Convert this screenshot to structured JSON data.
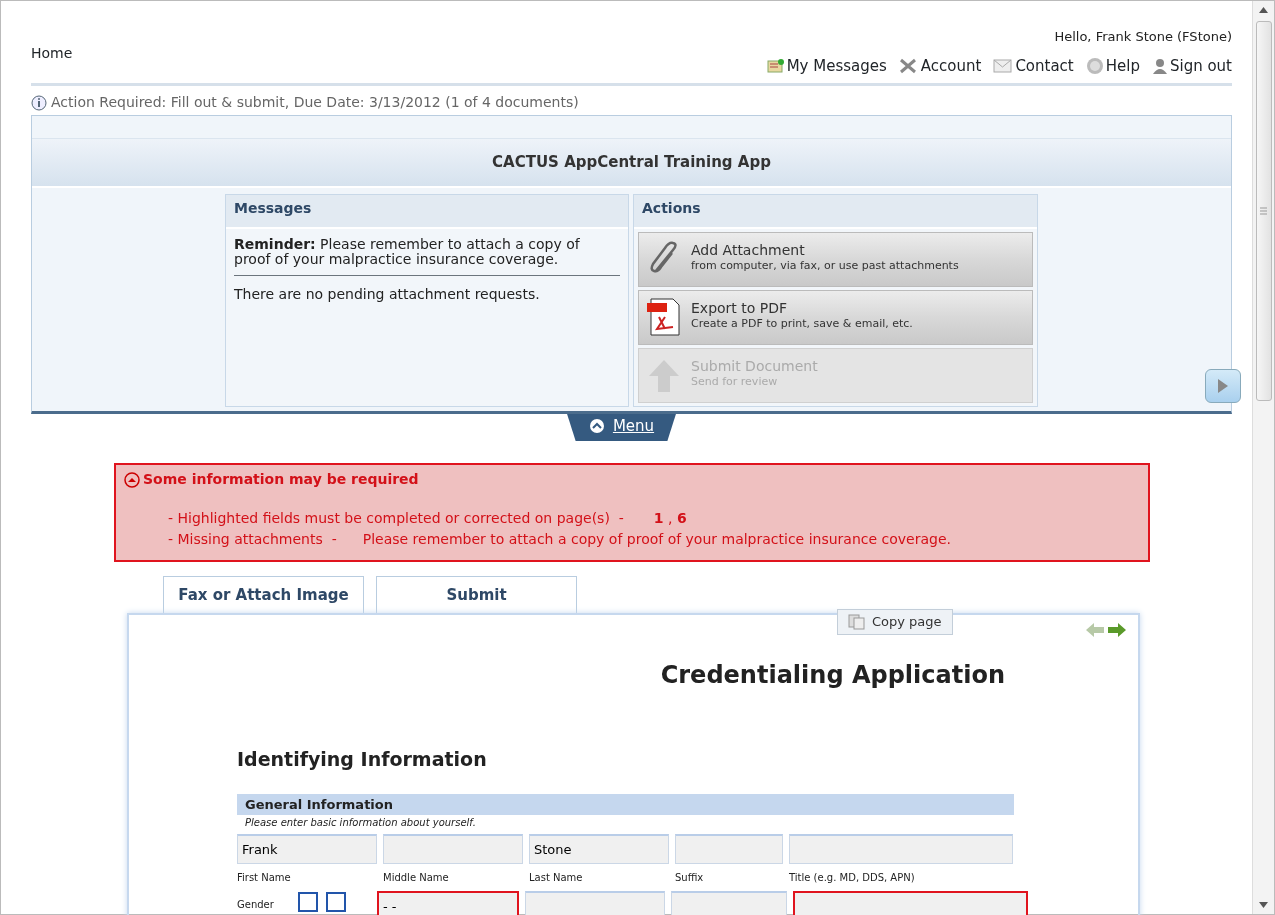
{
  "header": {
    "home": "Home",
    "greeting": "Hello, Frank Stone (FStone)",
    "links": [
      {
        "label": "My Messages"
      },
      {
        "label": "Account"
      },
      {
        "label": "Contact"
      },
      {
        "label": "Help"
      },
      {
        "label": "Sign out"
      }
    ]
  },
  "action_required": "Action Required: Fill out & submit, Due Date: 3/13/2012 (1 of 4 documents)",
  "app_panel": {
    "title": "CACTUS AppCentral Training App",
    "messages": {
      "heading": "Messages",
      "reminder": "**Reminder:** Please remember to attach a copy of proof of your malpractice insurance coverage.",
      "note": "There are no pending attachment requests."
    },
    "actions": {
      "heading": "Actions",
      "items": [
        {
          "title": "Add Attachment",
          "subtitle": "from computer, via fax, or use past attachments",
          "disabled": false
        },
        {
          "title": "Export to PDF",
          "subtitle": "Create a PDF to print, save & email, etc.",
          "disabled": false
        },
        {
          "title": "Submit Document",
          "subtitle": "Send for review",
          "disabled": true
        }
      ]
    }
  },
  "menu_tab": {
    "label": "Menu"
  },
  "alert": {
    "title": "Some information may be required",
    "lines": [
      {
        "text": "- Highlighted fields must be completed or corrected on page(s)  -",
        "links": [
          "1",
          "6"
        ],
        "separator": ","
      },
      {
        "text": "- Missing attachments  -",
        "detail": "Please remember to attach a copy of proof of your malpractice insurance coverage."
      }
    ]
  },
  "tabs": [
    {
      "label": "Fax or Attach Image"
    },
    {
      "label": "Submit"
    }
  ],
  "copy_page": "Copy page",
  "form": {
    "title": "Credentialing Application",
    "section": "Identifying Information",
    "group": "General Information",
    "hint": "Please enter basic information about yourself.",
    "name_fields": [
      {
        "value": "Frank",
        "label": "First Name",
        "invalid": false
      },
      {
        "label": "Middle Name",
        "invalid": false
      },
      {
        "value": "Stone",
        "label": "Last Name",
        "invalid": false
      },
      {
        "label": "Suffix",
        "invalid": false
      },
      {
        "label": "Title (e.g. MD, DDS, APN)",
        "invalid": false
      }
    ],
    "gender": {
      "label": "Gender",
      "options": [
        {
          "checked": false
        },
        {
          "checked": false
        }
      ]
    },
    "second_row": [
      {
        "value": "- -",
        "invalid": true
      },
      {
        "invalid": false
      },
      {
        "invalid": false
      },
      {
        "invalid": true
      }
    ]
  }
}
